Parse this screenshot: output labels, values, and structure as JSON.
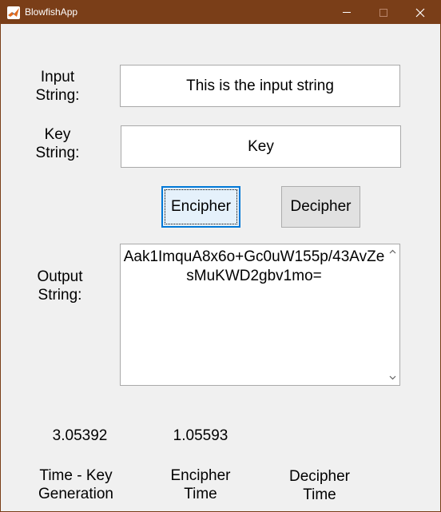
{
  "window": {
    "title": "BlowfishApp",
    "icon": "matlab-icon"
  },
  "labels": {
    "input_line1": "Input",
    "input_line2": "String:",
    "key_line1": "Key",
    "key_line2": "String:",
    "output_line1": "Output",
    "output_line2": "String:"
  },
  "inputs": {
    "input_string": "This is the input string",
    "key_string": "Key"
  },
  "buttons": {
    "encipher": "Encipher",
    "decipher": "Decipher"
  },
  "output": {
    "text": "Aak1ImquA8x6o+Gc0uW155p/43AvZesMuKWD2gbv1mo="
  },
  "times": {
    "key_generation_value": "3.05392",
    "encipher_value": "1.05593",
    "key_generation_line1": "Time - Key",
    "key_generation_line2": "Generation",
    "encipher_line1": "Encipher",
    "encipher_line2": "Time",
    "decipher_line1": "Decipher",
    "decipher_line2": "Time"
  },
  "colors": {
    "titlebar": "#7a3e18",
    "focus_border": "#0078d7"
  }
}
